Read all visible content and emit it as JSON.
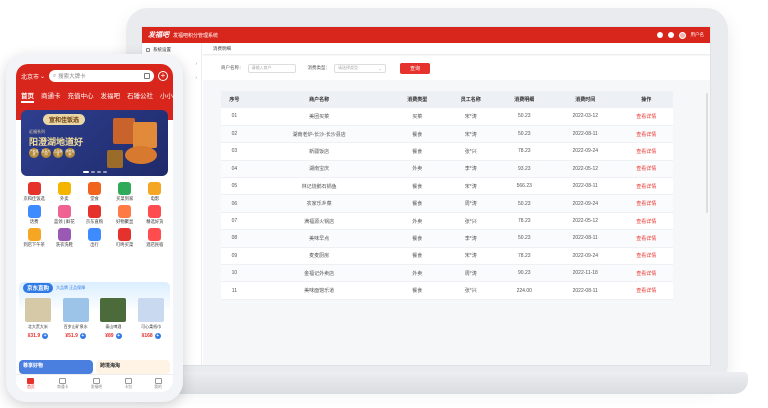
{
  "admin": {
    "logo": "发福吧",
    "system_title": "发福吧积分管理系统",
    "user_label": "用户名",
    "sidebar": [
      {
        "label": "系统设置"
      },
      {
        "label": ""
      },
      {
        "label": ""
      }
    ],
    "breadcrumb": "消费明细",
    "filters": {
      "merchant_label": "商户名称：",
      "merchant_placeholder": "请输入商户",
      "type_label": "消费类型：",
      "type_placeholder": "请选择类型",
      "query_button": "查询"
    },
    "table": {
      "headers": [
        "序号",
        "商户名称",
        "消费类型",
        "员工名称",
        "消费明细",
        "消费时间",
        "操作"
      ],
      "rows": [
        {
          "no": "01",
          "merchant": "美团买菜",
          "type": "买菜",
          "staff": "宋*涛",
          "amount": "50.23",
          "time": "2022-03-12",
          "op": "查看详情"
        },
        {
          "no": "02",
          "merchant": "湖南老炉-长沙-长沙县店",
          "type": "餐食",
          "staff": "宋*涛",
          "amount": "50.23",
          "time": "2022-08-11",
          "op": "查看详情"
        },
        {
          "no": "03",
          "merchant": "新疆饭店",
          "type": "餐食",
          "staff": "张*兴",
          "amount": "78.23",
          "time": "2022-09-24",
          "op": "查看详情"
        },
        {
          "no": "04",
          "merchant": "湖南宝庆",
          "type": "外卖",
          "staff": "李*涛",
          "amount": "93.23",
          "time": "2022-05-12",
          "op": "查看详情"
        },
        {
          "no": "05",
          "merchant": "林记烧鹅石锅鱼",
          "type": "餐食",
          "staff": "宋*涛",
          "amount": "566.23",
          "time": "2022-08-11",
          "op": "查看详情"
        },
        {
          "no": "06",
          "merchant": "农家乐乡菜",
          "type": "餐食",
          "staff": "周*涛",
          "amount": "50.23",
          "time": "2022-09-24",
          "op": "查看详情"
        },
        {
          "no": "07",
          "merchant": "满福源火锅店",
          "type": "外卖",
          "staff": "张*兴",
          "amount": "78.23",
          "time": "2022-05-12",
          "op": "查看详情"
        },
        {
          "no": "08",
          "merchant": "美味早点",
          "type": "餐食",
          "staff": "李*涛",
          "amount": "50.23",
          "time": "2022-08-11",
          "op": "查看详情"
        },
        {
          "no": "09",
          "merchant": "麦麦厨房",
          "type": "餐食",
          "staff": "宋*涛",
          "amount": "78.23",
          "time": "2022-09-24",
          "op": "查看详情"
        },
        {
          "no": "10",
          "merchant": "金福记外卖店",
          "type": "外卖",
          "staff": "周*涛",
          "amount": "90.23",
          "time": "2022-11-18",
          "op": "查看详情"
        },
        {
          "no": "11",
          "merchant": "美味面馆乐道",
          "type": "餐食",
          "staff": "张*兴",
          "amount": "224.00",
          "time": "2022-08-11",
          "op": "查看详情"
        }
      ]
    }
  },
  "mobile": {
    "city": "北京市",
    "search_placeholder": "搜索大牌卡",
    "tabs": [
      "首页",
      "商通卡",
      "充值中心",
      "发福吧",
      "石锤公社",
      "小小汇"
    ],
    "banner": {
      "pill": "宣和佳饭选",
      "subtitle": "近福系列",
      "title": "阳澄湖地道好",
      "badges": [
        "产地直发",
        "直采大闸",
        "正品保证",
        "顺丰包邮"
      ]
    },
    "icons": [
      {
        "label": "京和佳饭选",
        "color": "#e5322d"
      },
      {
        "label": "外卖",
        "color": "#f5b400"
      },
      {
        "label": "堂食",
        "color": "#f0641e"
      },
      {
        "label": "买菜到家",
        "color": "#2faa5a"
      },
      {
        "label": "电影",
        "color": "#f5a623"
      },
      {
        "label": "话费",
        "color": "#3d8bff"
      },
      {
        "label": "蓝领 | 鲜花",
        "color": "#f06292"
      },
      {
        "label": "京东直购",
        "color": "#e5322d"
      },
      {
        "label": "好物聚显",
        "color": "#ff7a45"
      },
      {
        "label": "精选好货",
        "color": "#ff4d4f"
      },
      {
        "label": "到店下午茶",
        "color": "#f5a623"
      },
      {
        "label": "洗衣洗鞋",
        "color": "#9b59b6"
      },
      {
        "label": "出行",
        "color": "#3d8bff"
      },
      {
        "label": "叮咚买菜",
        "color": "#e5322d"
      },
      {
        "label": "酒店民宿",
        "color": "#ff4d4f"
      }
    ],
    "jd": {
      "tag": "京东直购",
      "sub": "大品牌 正品保障",
      "products": [
        {
          "name": "北大荒大米",
          "price": "¥31.9",
          "color": "#d6c9a8"
        },
        {
          "name": "百岁山矿泉水",
          "price": "¥51.9",
          "color": "#9cc4e8"
        },
        {
          "name": "泰山啤酒",
          "price": "¥89",
          "color": "#4b6b3a"
        },
        {
          "name": "可心柔纸巾",
          "price": "¥168",
          "color": "#c9d9ef"
        }
      ]
    },
    "cards": [
      "尊享好物",
      "跨境海淘"
    ],
    "tabbar": [
      {
        "label": "首页",
        "active": true
      },
      {
        "label": "商通卡",
        "active": false
      },
      {
        "label": "发福吧",
        "active": false
      },
      {
        "label": "卡包",
        "active": false
      },
      {
        "label": "我的",
        "active": false
      }
    ]
  }
}
